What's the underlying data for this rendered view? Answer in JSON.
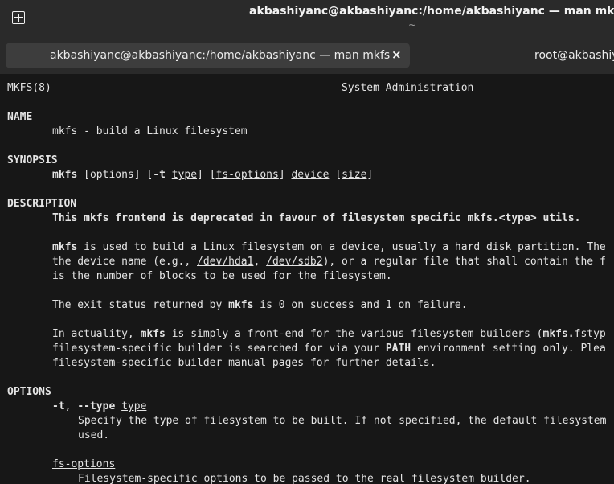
{
  "window": {
    "title": "akbashiyanc@akbashiyanc:/home/akbashiyanc — man mkfs",
    "subtitle": "~"
  },
  "tabs": [
    {
      "label": "akbashiyanc@akbashiyanc:/home/akbashiyanc — man mkfs",
      "close": "×"
    },
    {
      "label": "root@akbashiy"
    }
  ],
  "man": {
    "header_page": "MKFS",
    "header_section": "(8)",
    "header_center": "System Administration",
    "name_heading": "NAME",
    "name_text": "mkfs - build a Linux filesystem",
    "synopsis_heading": "SYNOPSIS",
    "syn_cmd": "mkfs",
    "syn_options": "[options]",
    "syn_t_open": "[",
    "syn_t_flag": "-t",
    "syn_t_arg": "type",
    "syn_t_close": "]",
    "syn_fsopt_open": "[",
    "syn_fsopt": "fs-options",
    "syn_fsopt_close": "]",
    "syn_device": "device",
    "syn_size_open": "[",
    "syn_size": "size",
    "syn_size_close": "]",
    "description_heading": "DESCRIPTION",
    "desc_deprecated": "This mkfs frontend is deprecated in favour of filesystem specific mkfs.<type> utils.",
    "p1_l1_cmd": "mkfs",
    "p1_l1_rest": " is used to build a Linux filesystem on a device, usually a hard disk partition. The",
    "p1_l2_a": "the device name (e.g., ",
    "p1_l2_dev1": "/dev/hda1",
    "p1_l2_b": ", ",
    "p1_l2_dev2": "/dev/sdb2",
    "p1_l2_c": "), or a regular file that shall contain the f",
    "p1_l3": "is the number of blocks to be used for the filesystem.",
    "p2_a": "The exit status returned by ",
    "p2_cmd": "mkfs",
    "p2_b": " is 0 on success and 1 on failure.",
    "p3_l1_a": "In actuality, ",
    "p3_l1_cmd": "mkfs",
    "p3_l1_b": " is simply a front-end for the various filesystem builders (",
    "p3_l1_cmd2": "mkfs.",
    "p3_l1_u": "fstyp",
    "p3_l2_a": "filesystem-specific builder is searched for via your ",
    "p3_l2_env": "PATH",
    "p3_l2_b": " environment setting only. Plea",
    "p3_l3": "filesystem-specific builder manual pages for further details.",
    "options_heading": "OPTIONS",
    "opt_t_short": "-t",
    "opt_t_sep": ", ",
    "opt_t_long": "--type",
    "opt_t_arg": "type",
    "opt_t_desc1_a": "Specify the ",
    "opt_t_desc1_u": "type",
    "opt_t_desc1_b": " of filesystem to be built. If not specified, the default filesystem",
    "opt_t_desc2": "used.",
    "opt_fs_label": "fs-options",
    "opt_fs_desc": "Filesystem-specific options to be passed to the real filesystem builder."
  }
}
